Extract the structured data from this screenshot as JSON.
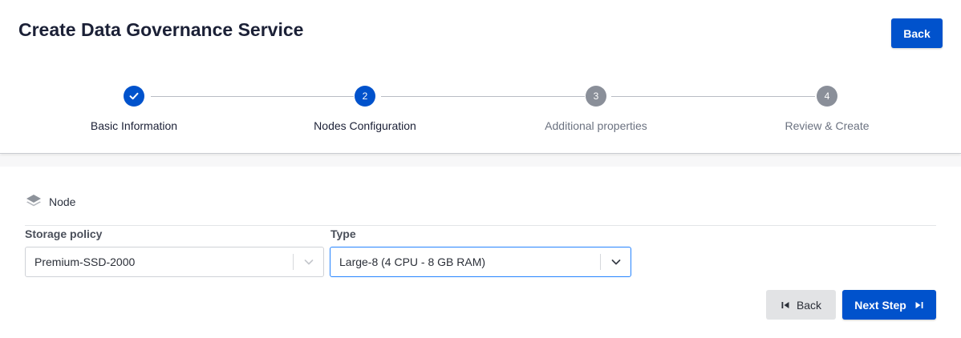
{
  "header": {
    "title": "Create Data Governance Service",
    "back_label": "Back"
  },
  "stepper": {
    "steps": [
      {
        "number": "1",
        "label": "Basic Information",
        "state": "completed",
        "icon": "check-icon"
      },
      {
        "number": "2",
        "label": "Nodes Configuration",
        "state": "current"
      },
      {
        "number": "3",
        "label": "Additional properties",
        "state": "upcoming"
      },
      {
        "number": "4",
        "label": "Review & Create",
        "state": "upcoming"
      }
    ]
  },
  "node_section": {
    "icon": "layers-icon",
    "title": "Node",
    "storage_policy": {
      "label": "Storage policy",
      "value": "Premium-SSD-2000"
    },
    "type": {
      "label": "Type",
      "value": "Large-8 (4 CPU - 8 GB RAM)"
    }
  },
  "footer": {
    "back_label": "Back",
    "back_icon": "skip-back-icon",
    "next_label": "Next Step",
    "next_icon": "skip-forward-icon"
  },
  "colors": {
    "primary": "#0052cc",
    "step_inactive": "#8a8f99",
    "focus_border": "#2684ff"
  }
}
